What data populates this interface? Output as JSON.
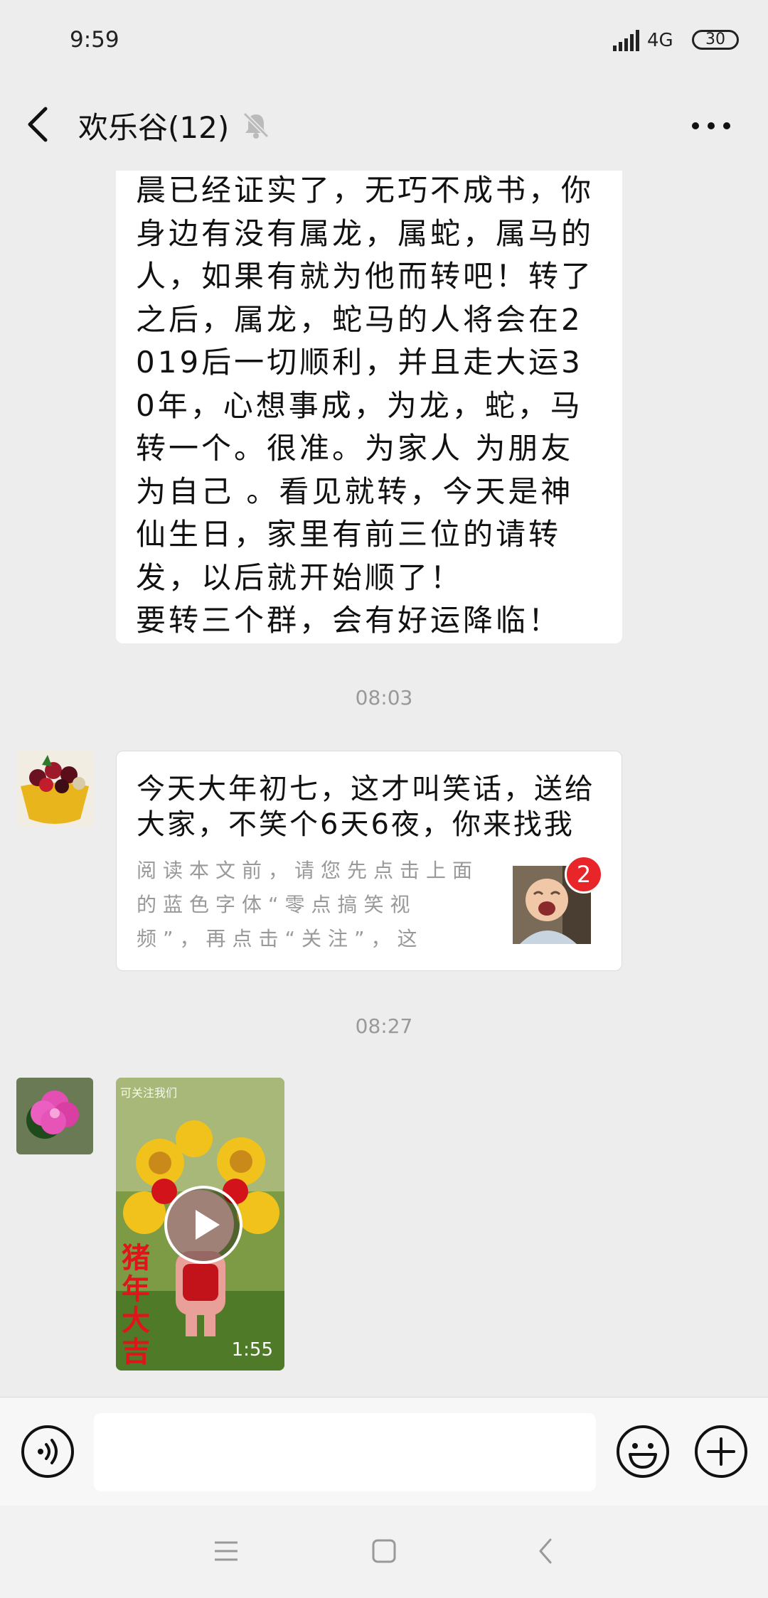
{
  "status_bar": {
    "time": "9:59",
    "network": "4G",
    "battery": "30"
  },
  "header": {
    "title": "欢乐谷(12)"
  },
  "messages": {
    "text_bubble": "晨已经证实了，无巧不成书，你身边有没有属龙，属蛇，属马的人，如果有就为他而转吧！转了之后，属龙，蛇马的人将会在2019后一切顺利，并且走大运30年，心想事成，为龙，蛇，马转一个。很准。为家人 为朋友 为自己 。看见就转，今天是神仙生日，家里有前三位的请转发，以后就开始顺了！\n要转三个群，会有好运降临！",
    "timestamp_1": "08:03",
    "card": {
      "title": "今天大年初七，这才叫笑话，送给大家，不笑个6天6夜，你来找我",
      "description": "阅读本文前，请您先点击上面的蓝色字体“零点搞笑视频”，再点击“关注”，这",
      "badge": "2"
    },
    "timestamp_2": "08:27",
    "video": {
      "caption": "可关注我们",
      "overlay_text": "猪年大吉",
      "duration": "1:55"
    }
  },
  "colors": {
    "background": "#ededed",
    "bubble": "#ffffff",
    "badge": "#e8262a"
  },
  "icons": [
    "back-icon",
    "mute-icon",
    "more-icon",
    "voice-icon",
    "emoji-icon",
    "plus-icon",
    "menu-icon",
    "home-icon",
    "back-nav-icon",
    "play-icon"
  ]
}
